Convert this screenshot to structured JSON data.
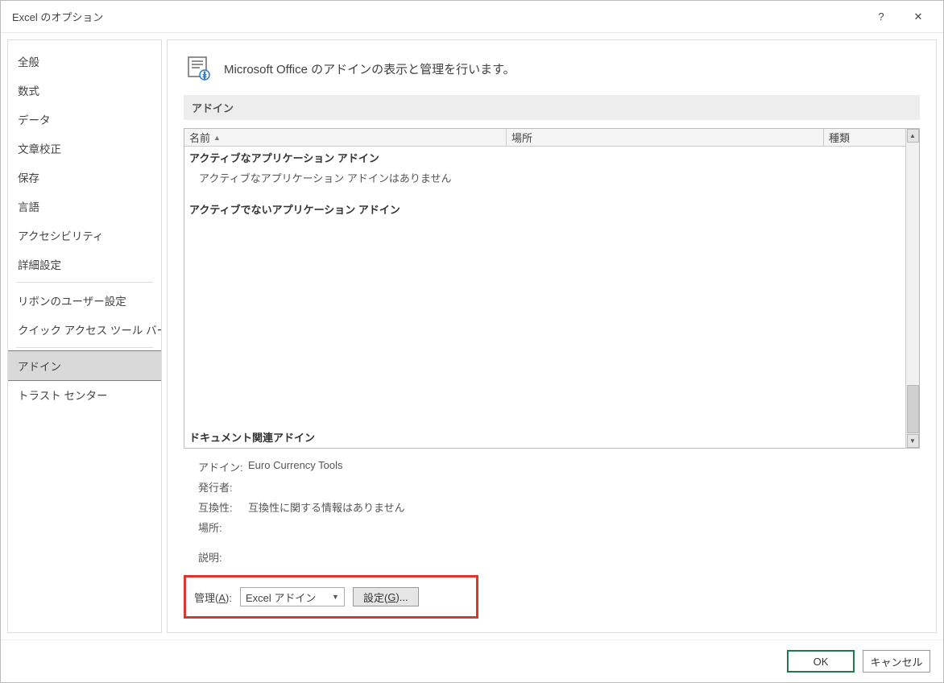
{
  "titlebar": {
    "title": "Excel のオプション",
    "help": "?",
    "close": "✕"
  },
  "sidebar": {
    "items": [
      "全般",
      "数式",
      "データ",
      "文章校正",
      "保存",
      "言語",
      "アクセシビリティ",
      "詳細設定"
    ],
    "items2": [
      "リボンのユーザー設定",
      "クイック アクセス ツール バー"
    ],
    "items3": [
      "アドイン",
      "トラスト センター"
    ],
    "selected": "アドイン"
  },
  "main": {
    "headline": "Microsoft Office のアドインの表示と管理を行います。",
    "section_title": "アドイン",
    "columns": {
      "name": "名前",
      "location": "場所",
      "type": "種類"
    },
    "groups": {
      "active": "アクティブなアプリケーション アドイン",
      "active_empty": "アクティブなアプリケーション アドインはありません",
      "inactive": "アクティブでないアプリケーション アドイン",
      "doc": "ドキュメント関連アドイン"
    },
    "details": {
      "labels": {
        "addin": "アドイン:",
        "publisher": "発行者:",
        "compat": "互換性:",
        "location": "場所:",
        "desc": "説明:"
      },
      "values": {
        "addin": "Euro Currency Tools",
        "publisher": "",
        "compat": "互換性に関する情報はありません",
        "location": "",
        "desc": ""
      }
    },
    "manage": {
      "label_prefix": "管理(",
      "label_accessA": "A",
      "label_suffix": "):",
      "select_value": "Excel アドイン",
      "go_prefix": "設定(",
      "go_accessG": "G",
      "go_suffix": ")..."
    }
  },
  "footer": {
    "ok": "OK",
    "cancel": "キャンセル"
  }
}
